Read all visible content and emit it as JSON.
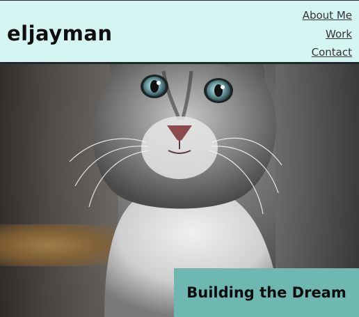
{
  "site": {
    "brand": "eljayman"
  },
  "nav": {
    "items": [
      "About Me",
      "Work",
      "Contact"
    ]
  },
  "hero": {
    "caption": "Building the Dream",
    "image_subject": "kitten"
  },
  "colors": {
    "header_bg": "#d4f5f1",
    "caption_bg": "#6fb8b2"
  }
}
